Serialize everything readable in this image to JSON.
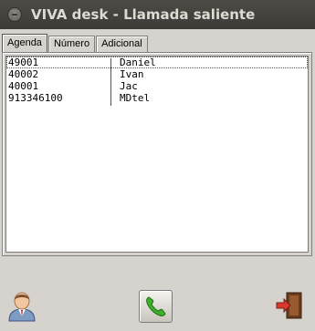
{
  "window": {
    "title": "VIVA desk - Llamada saliente"
  },
  "tabs": [
    {
      "label": "Agenda",
      "active": true
    },
    {
      "label": "Número",
      "active": false
    },
    {
      "label": "Adicional",
      "active": false
    }
  ],
  "agenda": {
    "rows": [
      {
        "number": "49001",
        "name": "Daniel",
        "selected": true
      },
      {
        "number": "40002",
        "name": "Ivan",
        "selected": false
      },
      {
        "number": "40001",
        "name": "Jac",
        "selected": false
      },
      {
        "number": "913346100",
        "name": "MDtel",
        "selected": false
      }
    ]
  },
  "buttons": {
    "contacts_icon": "user-avatar-icon",
    "call_icon": "phone-handset-icon",
    "exit_icon": "exit-door-icon"
  },
  "colors": {
    "call_green": "#3fae2a",
    "exit_red": "#d83a2b",
    "titlebar": "#3c3b37"
  }
}
